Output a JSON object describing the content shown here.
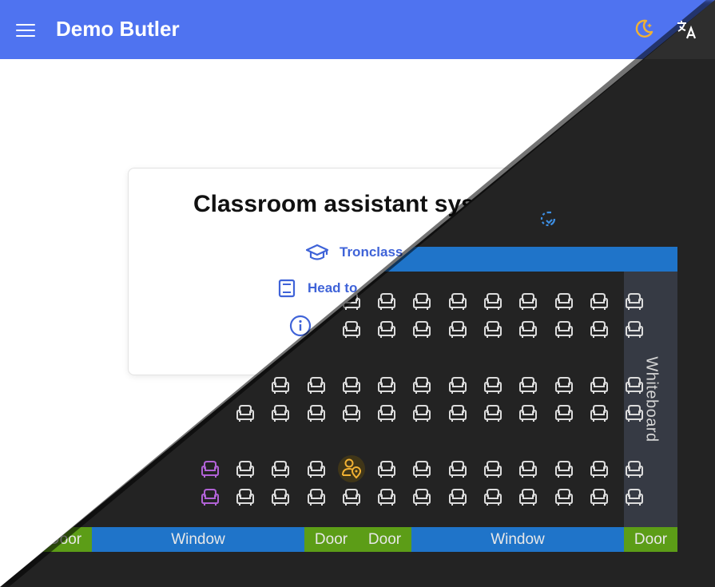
{
  "app": {
    "title": "Demo Butler"
  },
  "toolbar": {
    "theme_icon": "moon-icon",
    "language_icon": "translate-icon"
  },
  "card": {
    "title": "Classroom assistant sys",
    "links": [
      {
        "icon": "graduation-cap-icon",
        "label": "Tronclass"
      },
      {
        "icon": "book-icon",
        "label": "Head to"
      },
      {
        "icon": "info-icon",
        "label": ""
      }
    ]
  },
  "classroom": {
    "whiteboard_label": "Whiteboard",
    "reload_icon": "reload-icon",
    "bottom": [
      {
        "type": "door",
        "label": "Door"
      },
      {
        "type": "window",
        "label": "Window"
      },
      {
        "type": "door",
        "label": "Door"
      },
      {
        "type": "door",
        "label": "Door"
      },
      {
        "type": "window",
        "label": "Window"
      },
      {
        "type": "door",
        "label": "Door"
      }
    ],
    "seat_rows": [
      {
        "cols": [
          7,
          8,
          9,
          10,
          11,
          12,
          13,
          14,
          15
        ]
      },
      {
        "cols": [
          7,
          8,
          9,
          10,
          11,
          12,
          13,
          14,
          15
        ]
      },
      {
        "cols": [
          5,
          6,
          7,
          8,
          9,
          10,
          11,
          12,
          13,
          14,
          15
        ]
      },
      {
        "cols": [
          4,
          5,
          6,
          7,
          8,
          9,
          10,
          11,
          12,
          13,
          14,
          15
        ]
      },
      {
        "cols": [
          3,
          4,
          5,
          6,
          7,
          8,
          9,
          10,
          11,
          12,
          13,
          14,
          15
        ]
      },
      {
        "cols": [
          3,
          4,
          5,
          6,
          7,
          8,
          9,
          10,
          11,
          12,
          13,
          14,
          15
        ]
      }
    ],
    "selected_seat": {
      "row": 5,
      "col": 7,
      "icon": "person-pin-icon"
    },
    "highlighted_seats": [
      {
        "row": 5,
        "col": 3
      },
      {
        "row": 6,
        "col": 3
      }
    ],
    "colors": {
      "seat": "#dcdcdc",
      "seat_highlight": "#b162d6",
      "selected": "#f2b233",
      "door": "#5c9d17",
      "window": "#1f74c9",
      "whiteboard": "#363a44",
      "accent": "#4f73f0"
    }
  }
}
